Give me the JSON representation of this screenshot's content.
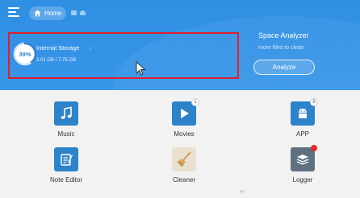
{
  "toolbar": {
    "home_label": "Home"
  },
  "storage": {
    "percent_label": "39%",
    "percent_used": 0.39,
    "title": "Internal Storage",
    "size": "3.01 GB / 7.75 GB",
    "arrow": "›"
  },
  "analyzer": {
    "title": "Space Analyzer",
    "subtitle": "more files to clean",
    "button_label": "Analyze"
  },
  "apps": [
    {
      "label": "Music",
      "icon": "music-icon",
      "color": "#2c83c9"
    },
    {
      "label": "Movies",
      "icon": "movies-icon",
      "color": "#2c83c9",
      "badge": "1"
    },
    {
      "label": "APP",
      "icon": "android-icon",
      "color": "#2c83c9",
      "badge": "8"
    },
    {
      "label": "Note Editor",
      "icon": "note-editor-icon",
      "color": "#2c83c9"
    },
    {
      "label": "Cleaner",
      "icon": "broom-icon",
      "color": "#2c83c9"
    },
    {
      "label": "Logger",
      "icon": "logger-icon",
      "color": "#5f7080"
    }
  ],
  "colors": {
    "header": "#3896e8",
    "highlight_border": "#e0202a",
    "accent": "#2c83c9"
  }
}
